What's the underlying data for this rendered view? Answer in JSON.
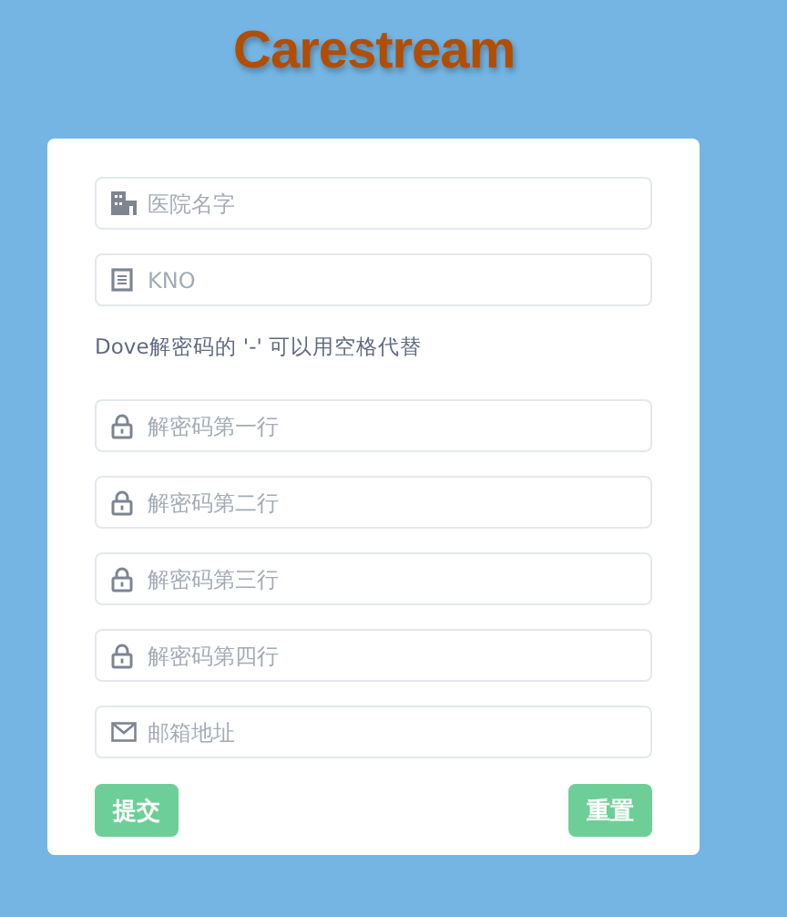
{
  "logo": "Carestream",
  "fields_top": [
    {
      "kind": "building",
      "placeholder": "医院名字"
    },
    {
      "kind": "document",
      "placeholder": "KNO"
    }
  ],
  "hint": "Dove解密码的 '-' 可以用空格代替",
  "fields_bottom": [
    {
      "kind": "lock",
      "placeholder": "解密码第一行"
    },
    {
      "kind": "lock",
      "placeholder": "解密码第二行"
    },
    {
      "kind": "lock",
      "placeholder": "解密码第三行"
    },
    {
      "kind": "lock",
      "placeholder": "解密码第四行"
    },
    {
      "kind": "mail",
      "placeholder": "邮箱地址"
    }
  ],
  "buttons": [
    "提交",
    "重置"
  ]
}
